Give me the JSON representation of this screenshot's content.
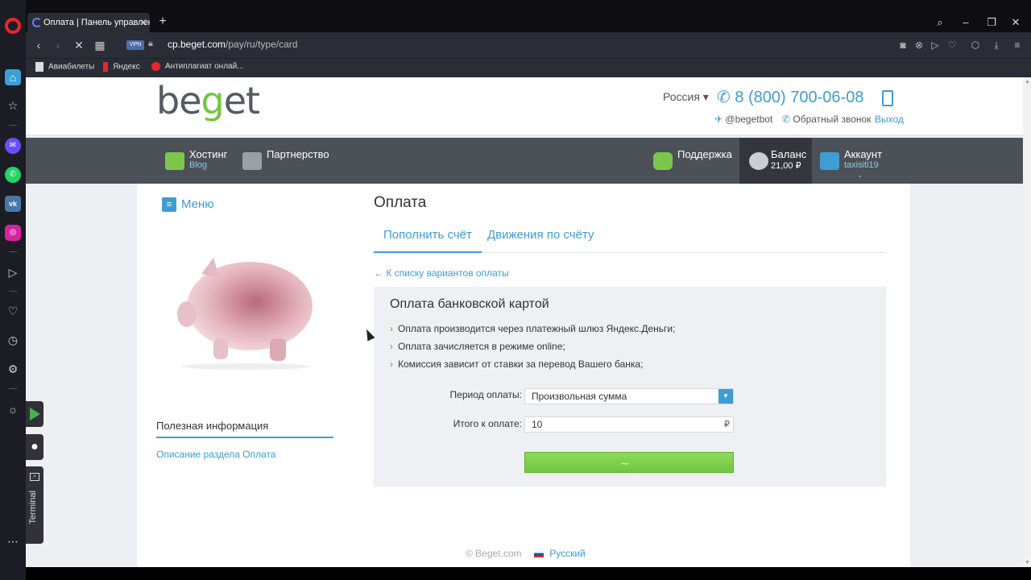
{
  "browser": {
    "tab_title": "Оплата | Панель управления",
    "url_domain": "cp.beget.com",
    "url_path": "/pay/ru/type/card",
    "vpn_badge": "VPN",
    "bookmarks": [
      "Авиабилеты",
      "Яндекс",
      "Антиплагиат онлай..."
    ]
  },
  "header": {
    "logo": "beget",
    "region": "Россия ▾",
    "phone": "8 (800) 700-06-08",
    "telegram": "@begetbot",
    "callback": "Обратный звонок",
    "logout": "Выход"
  },
  "nav": {
    "hosting": "Хостинг",
    "hosting_sub": "Blog",
    "partnership": "Партнерство",
    "support": "Поддержка",
    "balance": "Баланс",
    "balance_value": "21,00 ₽",
    "account": "Аккаунт",
    "account_user": "taxisiti19"
  },
  "sidebar": {
    "menu_label": "Меню",
    "useful_title": "Полезная информация",
    "useful_link": "Описание раздела Оплата"
  },
  "main": {
    "title": "Оплата",
    "tabs": [
      {
        "label": "Пополнить счёт"
      },
      {
        "label": "Движения по счёту"
      }
    ],
    "back_link": "← К списку вариантов оплаты",
    "card": {
      "title": "Оплата банковской картой",
      "bullets": [
        "Оплата производится через платежный шлюз Яндекс.Деньги;",
        "Оплата зачисляется в режиме online;",
        "Комиссия зависит от ставки за перевод Вашего банка;"
      ],
      "period_label": "Период оплаты:",
      "period_value": "Произвольная сумма",
      "total_label": "Итого к оплате:",
      "total_value": "10",
      "currency": "₽"
    }
  },
  "footer": {
    "copyright": "© Beget.com",
    "language": "Русский"
  },
  "sidebar_tools": {
    "terminal": "Terminal"
  },
  "colors": {
    "accent": "#3e9dd3",
    "green": "#6fc83f",
    "nav_bg": "#4c5158"
  }
}
